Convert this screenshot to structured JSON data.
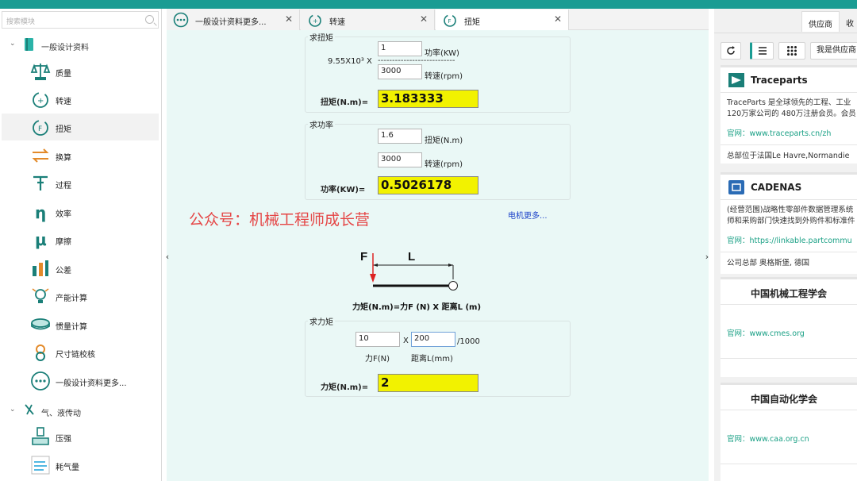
{
  "sidebar": {
    "search_placeholder": "搜索模块",
    "groups": [
      {
        "label": "一般设计资料"
      },
      {
        "label": "气、液传动"
      }
    ],
    "items": [
      {
        "label": "质量"
      },
      {
        "label": "转速"
      },
      {
        "label": "扭矩"
      },
      {
        "label": "换算"
      },
      {
        "label": "过程"
      },
      {
        "label": "效率"
      },
      {
        "label": "摩擦"
      },
      {
        "label": "公差"
      },
      {
        "label": "产能计算"
      },
      {
        "label": "惯量计算"
      },
      {
        "label": "尺寸链校核"
      },
      {
        "label": "一般设计资料更多..."
      },
      {
        "label": "压强"
      },
      {
        "label": "耗气量"
      }
    ]
  },
  "tabs": [
    {
      "label": "一般设计资料更多..."
    },
    {
      "label": "转速"
    },
    {
      "label": "扭矩"
    }
  ],
  "torque": {
    "title": "求扭矩",
    "power_value": "1",
    "power_label": "功率(KW)",
    "constant": "9.55X10³ X",
    "dashes": "---------------------------",
    "speed_value": "3000",
    "speed_label": "转速(rpm)",
    "result_label": "扭矩(N.m)=",
    "result_value": "3.183333"
  },
  "power": {
    "title": "求功率",
    "torque_value": "1.6",
    "torque_label": "扭矩(N.m)",
    "speed_value": "3000",
    "speed_label": "转速(rpm)",
    "result_label": "功率(KW)=",
    "result_value": "0.5026178"
  },
  "watermark": "公众号：机械工程师成长营",
  "motor_link": "电机更多...",
  "diagram": {
    "force_label": "F",
    "length_label": "L",
    "formula": "力矩(N.m)=力F (N) X 距离L (m)"
  },
  "moment": {
    "title": "求力矩",
    "force_value": "10",
    "times": "X",
    "distance_value": "200",
    "divisor": "/1000",
    "force_label": "力F(N)",
    "distance_label": "距离L(mm)",
    "result_label": "力矩(N.m)=",
    "result_value": "2"
  },
  "right": {
    "tabs": [
      {
        "label": "供应商"
      },
      {
        "label": "收"
      }
    ],
    "supplier_button": "我是供应商",
    "cards": [
      {
        "title": "Traceparts",
        "desc_line1": "TraceParts 是全球领先的工程、工业",
        "desc_line2": "120万家公司的 480万注册会员。会员",
        "website": "官网：www.traceparts.cn/zh",
        "hq": "总部位于法国Le Havre,Normandie"
      },
      {
        "title": "CADENAS",
        "desc_line1": "(经营范围)战略性零部件数据管理系统",
        "desc_line2": "师和采购部门快速找到外购件和标准件",
        "website": "官网：https://linkable.partcommu",
        "hq": "公司总部  奥格斯堡, 德国"
      },
      {
        "title": "中国机械工程学会",
        "website": "官网：www.cmes.org"
      },
      {
        "title": "中国自动化学会",
        "website": "官网：www.caa.org.cn"
      }
    ]
  },
  "colors": {
    "accent": "#1a9c93",
    "result_bg": "#f2f200",
    "watermark": "#e54646",
    "link": "#1a40c8",
    "green_link": "#1aa085"
  }
}
